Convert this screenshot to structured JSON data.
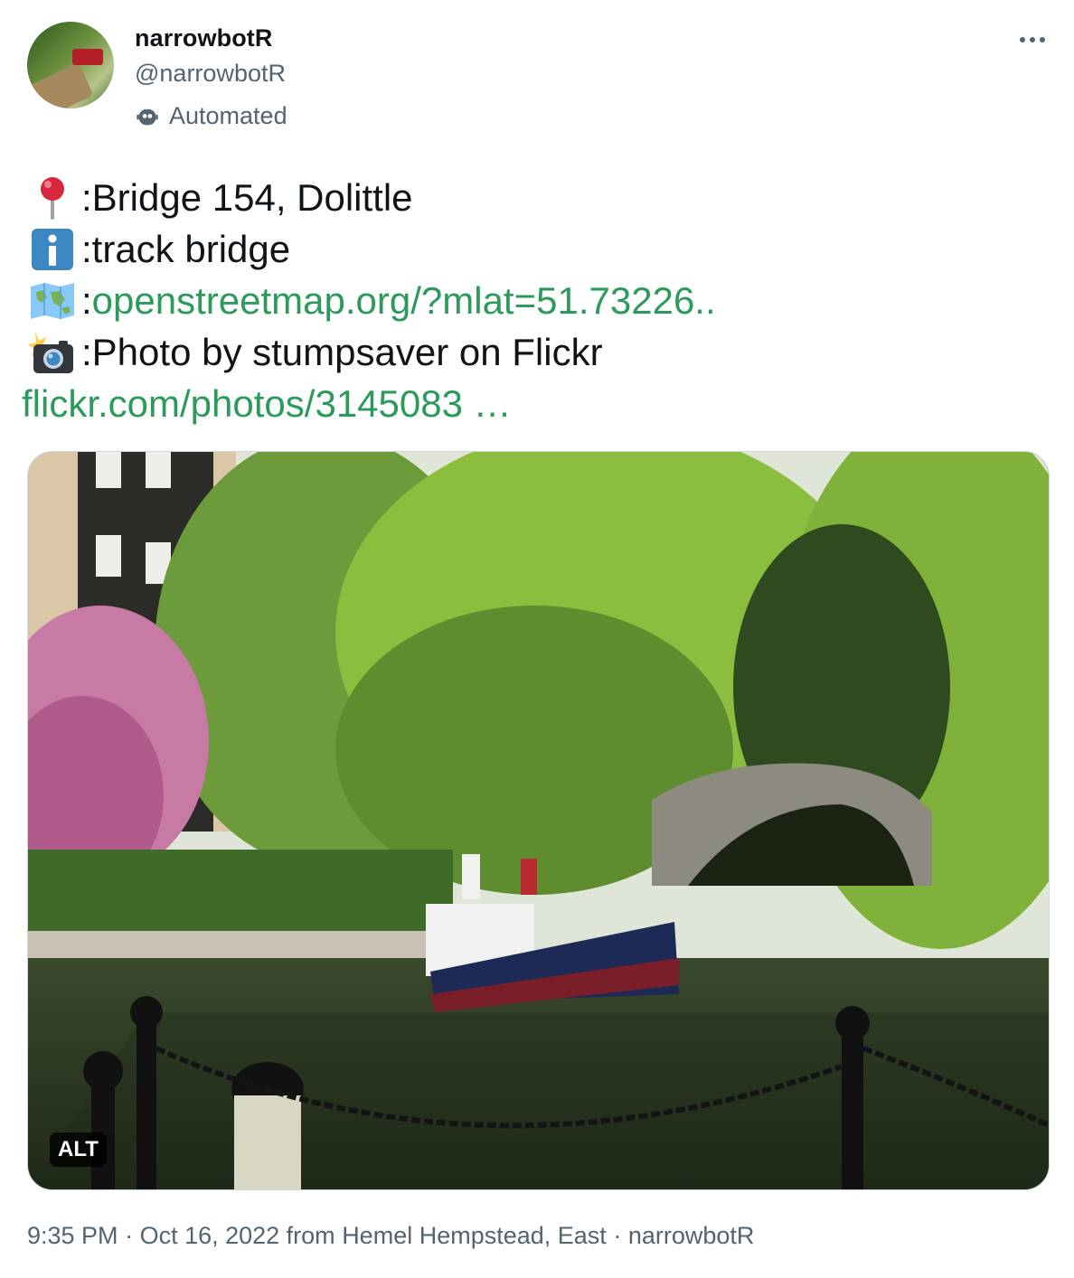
{
  "author": {
    "display_name": "narrowbotR",
    "handle": "@narrowbotR",
    "label": "Automated"
  },
  "tweet": {
    "lines": [
      {
        "icon": "round-pushpin-icon",
        "prefix": ": ",
        "text": "Bridge 154, Dolittle"
      },
      {
        "icon": "information-icon",
        "prefix": ": ",
        "text": "track bridge"
      },
      {
        "icon": "world-map-icon",
        "prefix": ": ",
        "link": "openstreetmap.org/?mlat=51.73226.."
      },
      {
        "icon": "camera-with-flash-icon",
        "prefix": ": ",
        "text": "Photo by stumpsaver on Flickr"
      }
    ],
    "trailing_link": "flickr.com/photos/3145083 …"
  },
  "media": {
    "alt_label": "ALT",
    "description_icon": "narrowboat-canal-photo"
  },
  "meta": {
    "time": "9:35 PM",
    "sep1": " · ",
    "date": "Oct 16, 2022",
    "from_text": " from ",
    "location": "Hemel Hempstead, East",
    "sep2": " · ",
    "source": "narrowbotR"
  },
  "colors": {
    "link": "#2c9a5a",
    "secondary_text": "#536471",
    "border": "#cfd9de"
  }
}
